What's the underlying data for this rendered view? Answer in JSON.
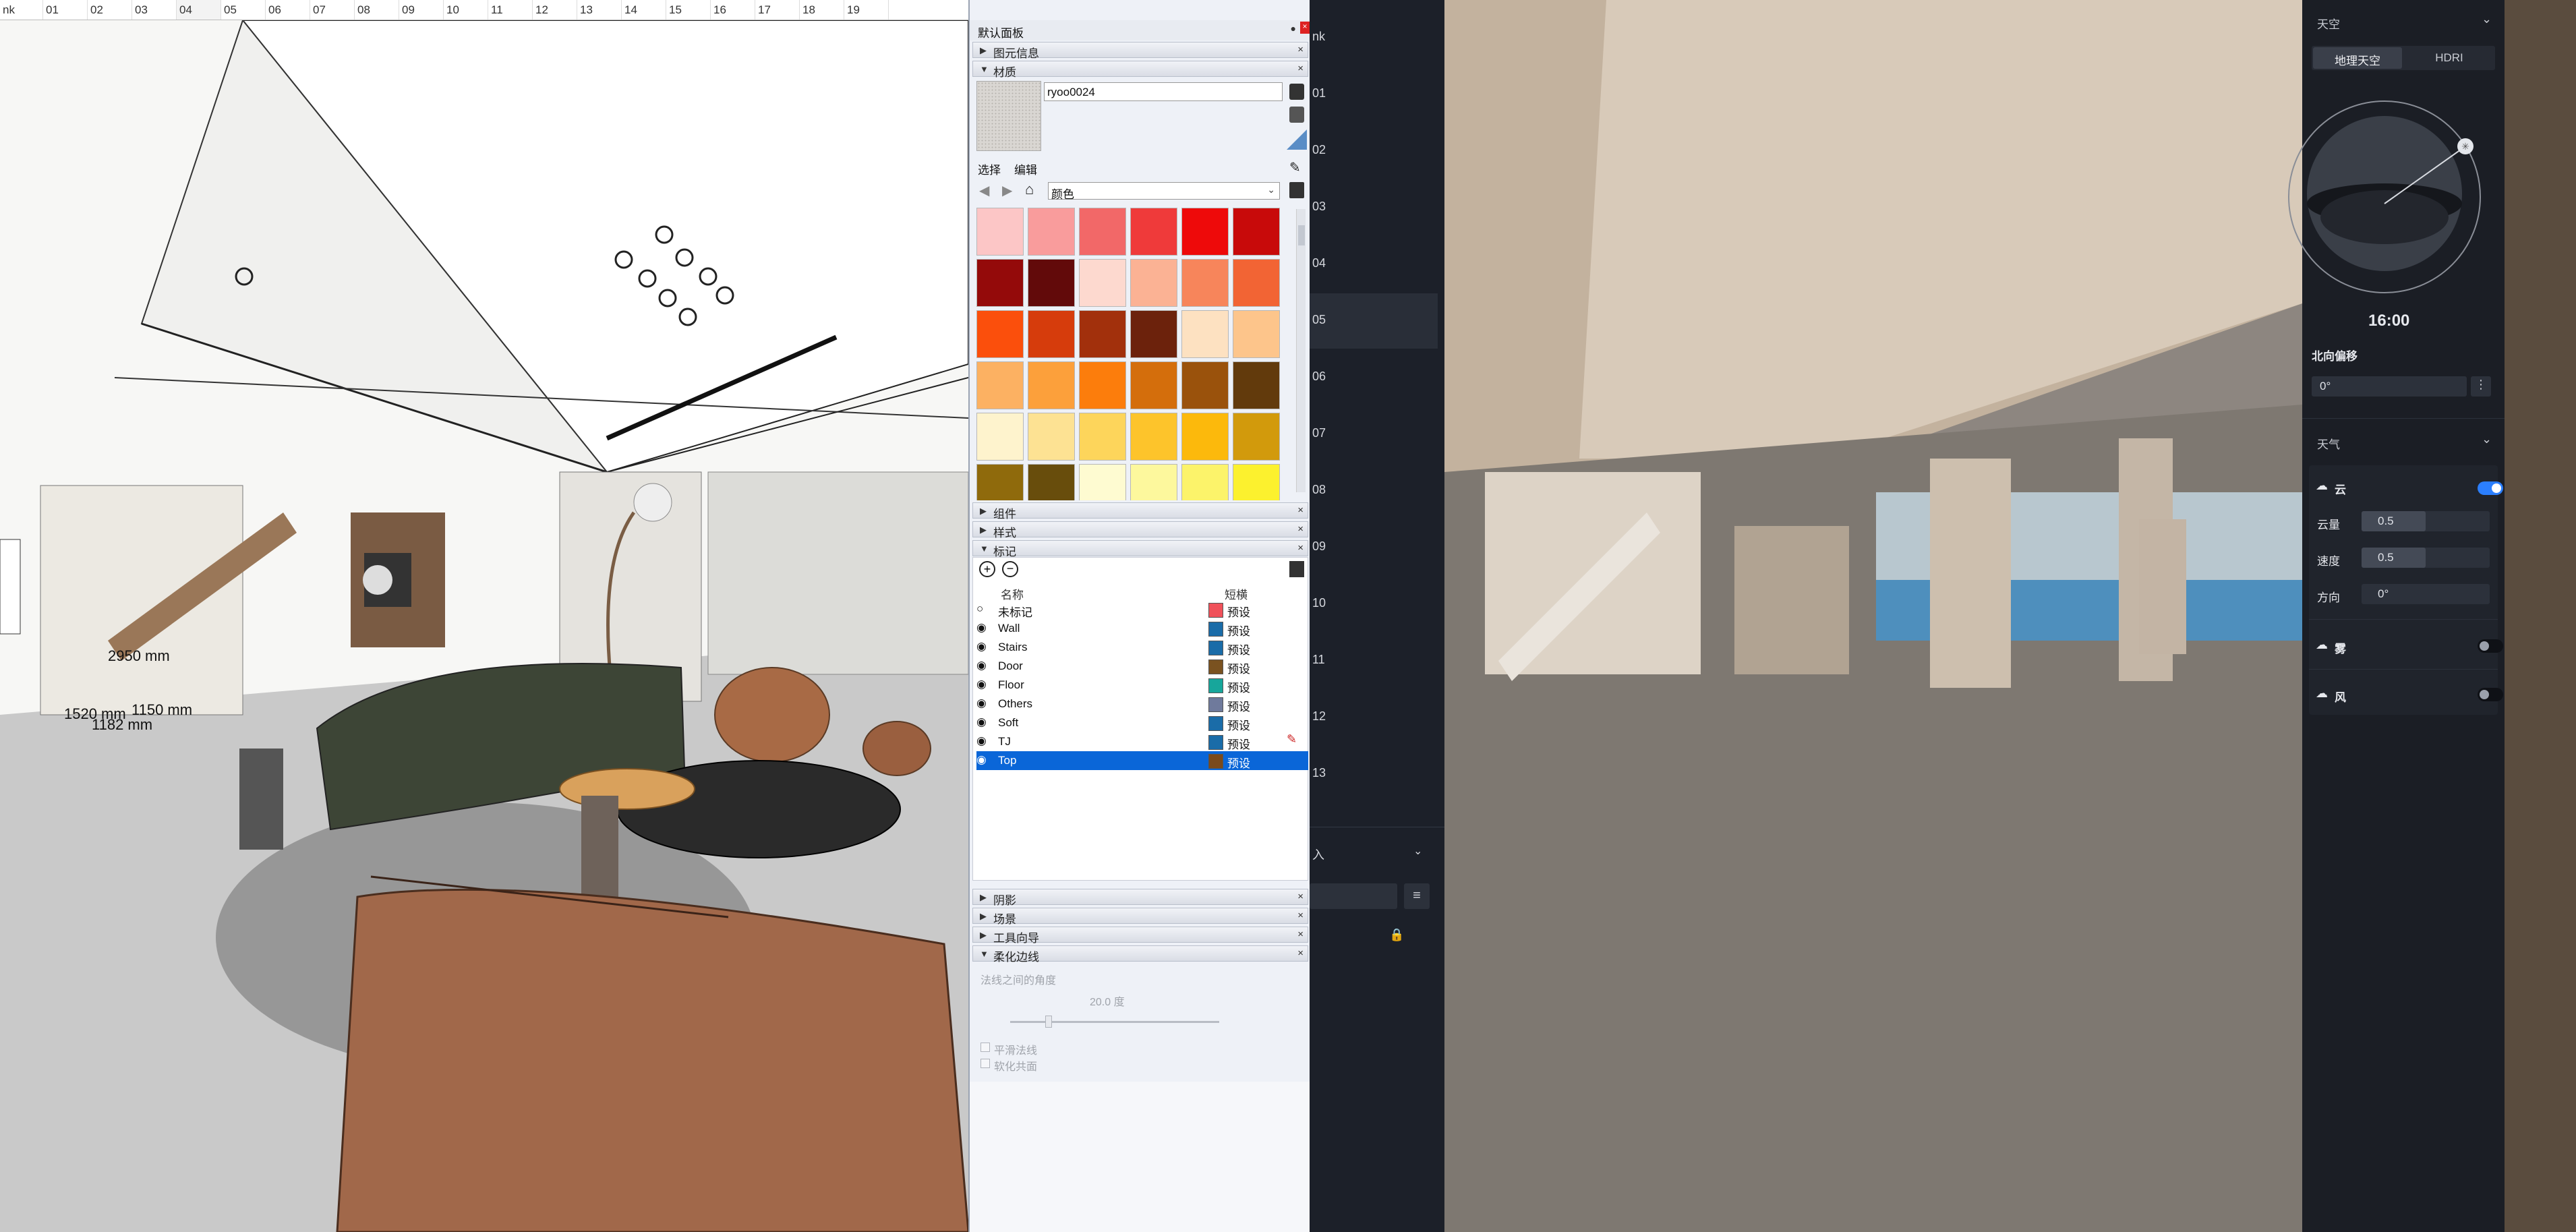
{
  "sketchup": {
    "tabs": [
      "nk",
      "01",
      "02",
      "03",
      "04",
      "05",
      "06",
      "07",
      "08",
      "09",
      "10",
      "11",
      "12",
      "13",
      "14",
      "15",
      "16",
      "17",
      "18",
      "19"
    ],
    "active_tab": "04",
    "dim_labels": [
      "2950 mm",
      "1520 mm",
      "1150 mm",
      "1182 mm"
    ]
  },
  "tray": {
    "title": "默认面板",
    "entity_info": "图元信息",
    "materials": {
      "title": "材质",
      "name_value": "ryoo0024",
      "tab_select": "选择",
      "tab_edit": "编辑",
      "library": "颜色",
      "swatches": [
        "#fcc6c6",
        "#f99c9c",
        "#f26868",
        "#ef3a3a",
        "#ee0a0a",
        "#c80a0a",
        "#940a0a",
        "#620a0a",
        "#fdd9cf",
        "#fbb294",
        "#f7855b",
        "#f26434",
        "#fb4f0c",
        "#d63c0c",
        "#a2300c",
        "#6c220c",
        "#fde1c1",
        "#fdc58b",
        "#fcb162",
        "#fca03b",
        "#fc7d0c",
        "#d46e0c",
        "#9a520c",
        "#623a0c",
        "#fef3cd",
        "#fde293",
        "#fdd55b",
        "#fdc42b",
        "#fcb90c",
        "#d29a0c",
        "#8f6a0c",
        "#684d0c",
        "#fefbd1",
        "#fdf89d",
        "#fcf36a",
        "#fcf12e"
      ]
    },
    "components": "组件",
    "styles": "样式",
    "tags": {
      "title": "标记",
      "col_name": "名称",
      "col_dash": "短横",
      "rows": [
        {
          "name": "未标记",
          "color": "#f0515a",
          "dash": "预设",
          "visible": false
        },
        {
          "name": "Wall",
          "color": "#1a6ca8",
          "dash": "预设",
          "visible": true
        },
        {
          "name": "Stairs",
          "color": "#1a6ca8",
          "dash": "预设",
          "visible": true
        },
        {
          "name": "Door",
          "color": "#7a5220",
          "dash": "预设",
          "visible": true
        },
        {
          "name": "Floor",
          "color": "#17a69b",
          "dash": "预设",
          "visible": true
        },
        {
          "name": "Others",
          "color": "#6f7a9c",
          "dash": "预设",
          "visible": true
        },
        {
          "name": "Soft",
          "color": "#1a6ca8",
          "dash": "预设",
          "visible": true
        },
        {
          "name": "TJ",
          "color": "#1a6ca8",
          "dash": "预设",
          "visible": true
        },
        {
          "name": "Top",
          "color": "#7a4a1c",
          "dash": "预设",
          "visible": true
        }
      ]
    },
    "shadows": "阴影",
    "scenes": "场景",
    "instructor": "工具向导",
    "soften": {
      "title": "柔化边线",
      "angle_label": "法线之间的角度",
      "angle_value": "20.0  度",
      "smooth_normals": "平滑法线",
      "soften_coplanar": "软化共面"
    }
  },
  "render": {
    "scene_numbers": [
      "nk",
      "01",
      "02",
      "03",
      "04",
      "05",
      "06",
      "07",
      "08",
      "09",
      "10",
      "11",
      "12",
      "13"
    ],
    "active_scene": "05",
    "import_label": "入",
    "sky": {
      "title": "天空",
      "tab_geo": "地理天空",
      "tab_hdri": "HDRI",
      "time": "16:00",
      "north_label": "北向偏移",
      "north_value": "0°"
    },
    "weather": {
      "title": "天气",
      "cloud_label": "云",
      "cloud_on": true,
      "amount_label": "云量",
      "amount_value": "0.5",
      "amount_level": 0.5,
      "speed_label": "速度",
      "speed_value": "0.5",
      "speed_level": 0.5,
      "direction_label": "方向",
      "direction_value": "0°",
      "fog_label": "雾",
      "fog_on": false,
      "wind_label": "风",
      "wind_on": false
    }
  }
}
